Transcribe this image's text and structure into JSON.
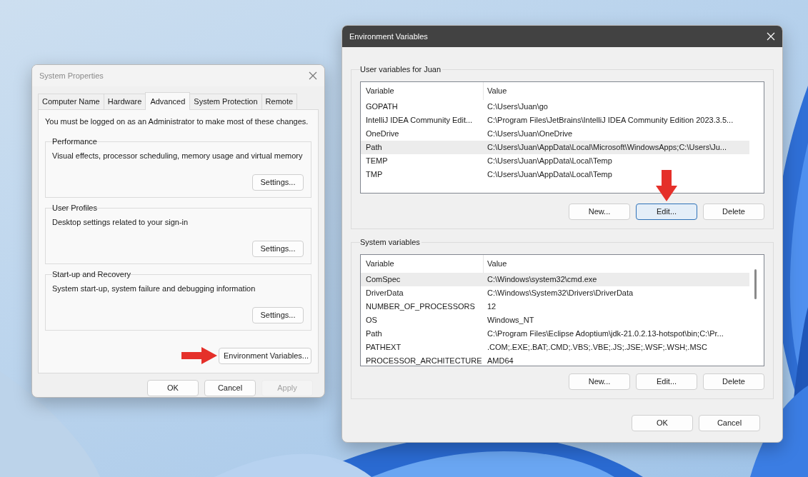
{
  "system_properties": {
    "title": "System Properties",
    "active": false,
    "tabs": [
      {
        "label": "Computer Name",
        "selected": false
      },
      {
        "label": "Hardware",
        "selected": false
      },
      {
        "label": "Advanced",
        "selected": true
      },
      {
        "label": "System Protection",
        "selected": false
      },
      {
        "label": "Remote",
        "selected": false
      }
    ],
    "notice": "You must be logged on as an Administrator to make most of these changes.",
    "groups": [
      {
        "title": "Performance",
        "description": "Visual effects, processor scheduling, memory usage and virtual memory",
        "button": "Settings..."
      },
      {
        "title": "User Profiles",
        "description": "Desktop settings related to your sign-in",
        "button": "Settings..."
      },
      {
        "title": "Start-up and Recovery",
        "description": "System start-up, system failure and debugging information",
        "button": "Settings..."
      }
    ],
    "env_button": "Environment Variables...",
    "footer_buttons": [
      {
        "label": "OK",
        "disabled": false
      },
      {
        "label": "Cancel",
        "disabled": false
      },
      {
        "label": "Apply",
        "disabled": true
      }
    ]
  },
  "environment_variables": {
    "title": "Environment Variables",
    "active": true,
    "sections": [
      {
        "title": "User variables for Juan",
        "columns": [
          "Variable",
          "Value"
        ],
        "rows": [
          {
            "variable": "GOPATH",
            "value": "C:\\Users\\Juan\\go",
            "selected": false
          },
          {
            "variable": "IntelliJ IDEA Community Edit...",
            "value": "C:\\Program Files\\JetBrains\\IntelliJ IDEA Community Edition 2023.3.5...",
            "selected": false
          },
          {
            "variable": "OneDrive",
            "value": "C:\\Users\\Juan\\OneDrive",
            "selected": false
          },
          {
            "variable": "Path",
            "value": "C:\\Users\\Juan\\AppData\\Local\\Microsoft\\WindowsApps;C:\\Users\\Ju...",
            "selected": true
          },
          {
            "variable": "TEMP",
            "value": "C:\\Users\\Juan\\AppData\\Local\\Temp",
            "selected": false
          },
          {
            "variable": "TMP",
            "value": "C:\\Users\\Juan\\AppData\\Local\\Temp",
            "selected": false
          }
        ],
        "scrollbar": false,
        "buttons": [
          {
            "label": "New...",
            "focused": false
          },
          {
            "label": "Edit...",
            "focused": true
          },
          {
            "label": "Delete",
            "focused": false
          }
        ]
      },
      {
        "title": "System variables",
        "columns": [
          "Variable",
          "Value"
        ],
        "rows": [
          {
            "variable": "ComSpec",
            "value": "C:\\Windows\\system32\\cmd.exe",
            "selected": true
          },
          {
            "variable": "DriverData",
            "value": "C:\\Windows\\System32\\Drivers\\DriverData",
            "selected": false
          },
          {
            "variable": "NUMBER_OF_PROCESSORS",
            "value": "12",
            "selected": false
          },
          {
            "variable": "OS",
            "value": "Windows_NT",
            "selected": false
          },
          {
            "variable": "Path",
            "value": "C:\\Program Files\\Eclipse Adoptium\\jdk-21.0.2.13-hotspot\\bin;C:\\Pr...",
            "selected": false
          },
          {
            "variable": "PATHEXT",
            "value": ".COM;.EXE;.BAT;.CMD;.VBS;.VBE;.JS;.JSE;.WSF;.WSH;.MSC",
            "selected": false
          },
          {
            "variable": "PROCESSOR_ARCHITECTURE",
            "value": "AMD64",
            "selected": false
          }
        ],
        "scrollbar": true,
        "buttons": [
          {
            "label": "New...",
            "focused": false
          },
          {
            "label": "Edit...",
            "focused": false
          },
          {
            "label": "Delete",
            "focused": false
          }
        ]
      }
    ],
    "footer_buttons": [
      {
        "label": "OK",
        "disabled": false
      },
      {
        "label": "Cancel",
        "disabled": false
      }
    ]
  }
}
